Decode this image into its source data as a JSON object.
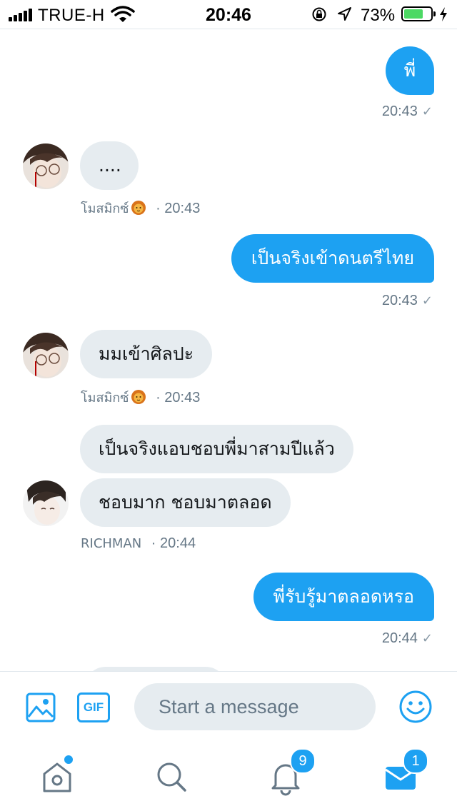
{
  "status_bar": {
    "carrier": "TRUE-H",
    "time": "20:46",
    "battery_percent": "73%",
    "battery_level": 0.73,
    "battery_color": "#4cd964"
  },
  "colors": {
    "accent": "#1da1f2",
    "incoming_bubble": "#e6ecf0",
    "meta_text": "#657786"
  },
  "messages": [
    {
      "direction": "out",
      "text": "พี่",
      "time": "20:43",
      "check_icon": "check-icon"
    },
    {
      "direction": "in",
      "text": "....",
      "sender": "โมสมิกซ์",
      "sender_emoji": "lion-emoji",
      "time": "· 20:43"
    },
    {
      "direction": "out",
      "text": "เป็นจริงเข้าดนตรีไทย",
      "time": "20:43",
      "check_icon": "check-icon"
    },
    {
      "direction": "in",
      "text": "มมเข้าศิลปะ",
      "sender": "โมสมิกซ์",
      "sender_emoji": "lion-emoji",
      "time": "· 20:43"
    },
    {
      "direction": "in",
      "text": "เป็นจริงแอบชอบพี่มาสามปีแล้ว"
    },
    {
      "direction": "in",
      "text": "ชอบมาก ชอบมาตลอด",
      "sender": "RICHMAN",
      "time": "· 20:44"
    },
    {
      "direction": "out",
      "text": "พี่รับรู้มาตลอดหรอ",
      "time": "20:44",
      "check_icon": "check-icon"
    }
  ],
  "composer": {
    "image_icon": "image-icon",
    "gif_label": "GIF",
    "placeholder": "Start a message",
    "emoji_icon": "smiley-icon"
  },
  "tabbar": {
    "home_icon": "home-icon",
    "search_icon": "search-icon",
    "notifications_icon": "bell-icon",
    "notifications_badge": "9",
    "messages_icon": "envelope-icon",
    "messages_badge": "1"
  }
}
